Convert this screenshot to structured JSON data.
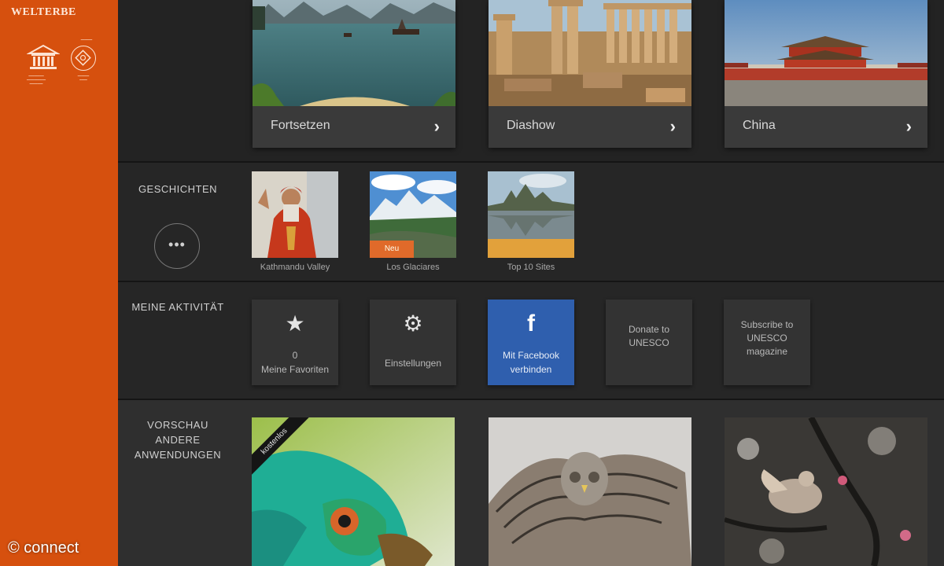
{
  "app": {
    "brand": "WELTERBE"
  },
  "logos": {
    "unesco_icon": "unesco-temple-logo",
    "whc_icon": "world-heritage-emblem"
  },
  "watermark": "© connect",
  "top_cards": [
    {
      "label": "Fortsetzen",
      "icon": "chevron-right-icon"
    },
    {
      "label": "Diashow",
      "icon": "chevron-right-icon"
    },
    {
      "label": "China",
      "icon": "chevron-right-icon"
    }
  ],
  "chevron": "›",
  "stories": {
    "label": "GESCHICHTEN",
    "more": "•••",
    "items": [
      {
        "label": "Kathmandu Valley"
      },
      {
        "label": "Los Glaciares",
        "badge": "Neu"
      },
      {
        "label": "Top 10 Sites"
      }
    ]
  },
  "activity": {
    "label": "MEINE AKTIVITÄT",
    "favorites": {
      "icon": "★",
      "count": "0",
      "label": "Meine Favoriten"
    },
    "settings": {
      "icon": "⚙",
      "label": "Einstellungen"
    },
    "facebook": {
      "icon": "f",
      "label": "Mit Facebook verbinden"
    },
    "donate": {
      "label": "Donate to UNESCO"
    },
    "subscribe": {
      "label": "Subscribe to UNESCO magazine"
    }
  },
  "preview": {
    "label": "VORSCHAU ANDERE ANWENDUNGEN",
    "ribbon": "kostenlos"
  },
  "colors": {
    "sidebar": "#d6500e",
    "facebook": "#2f5fae",
    "badge": "#e06a2a"
  }
}
